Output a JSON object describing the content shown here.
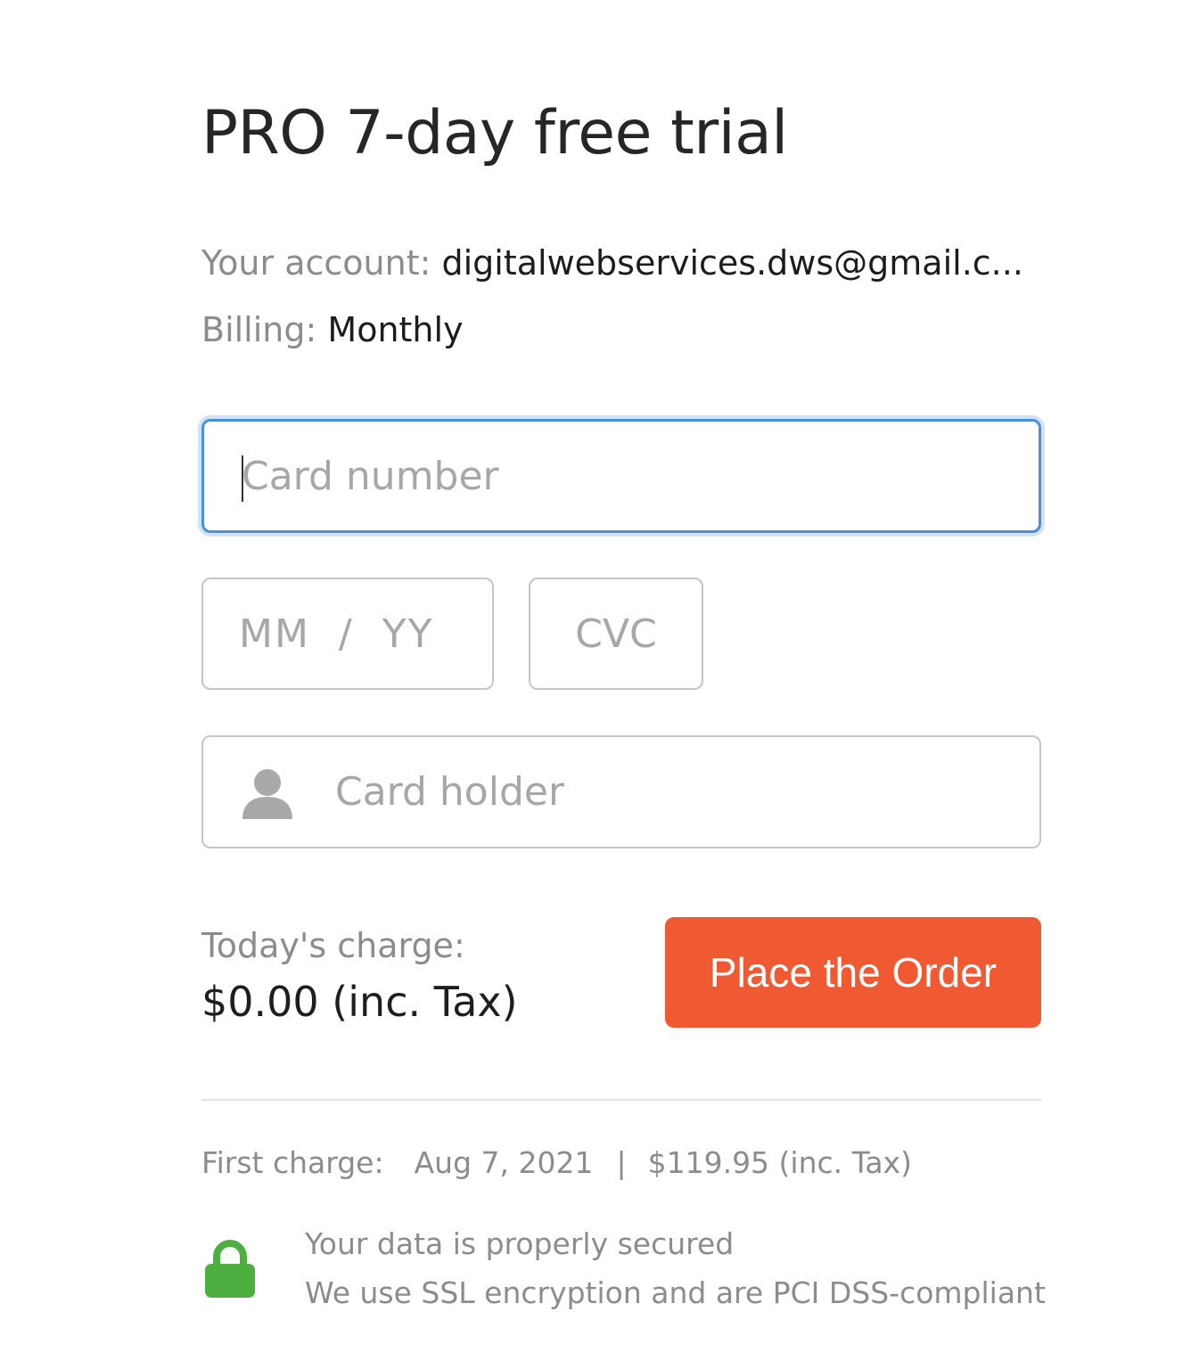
{
  "title": "PRO 7-day free trial",
  "account": {
    "label": "Your account:",
    "value": "digitalwebservices.dws@gmail.c..."
  },
  "billing": {
    "label": "Billing:",
    "value": "Monthly"
  },
  "form": {
    "card_number_placeholder": "Card number",
    "expiry_placeholder": "MM  /  YY",
    "cvc_placeholder": "CVC",
    "card_holder_placeholder": "Card holder",
    "card_holder_icon": "person-icon"
  },
  "charge": {
    "label": "Today's charge:",
    "amount": "$0.00 (inc. Tax)"
  },
  "order_button": {
    "label": "Place the Order",
    "color": "#f05a33"
  },
  "first_charge": {
    "label": "First charge:",
    "date": "Aug 7, 2021",
    "separator": "|",
    "amount": "$119.95 (inc. Tax)"
  },
  "security": {
    "icon": "lock-icon",
    "icon_color": "#4caf3f",
    "title": "Your data is properly secured",
    "subtitle": "We use SSL encryption and are PCI DSS-compliant"
  },
  "focus_color": "#4a90d9"
}
